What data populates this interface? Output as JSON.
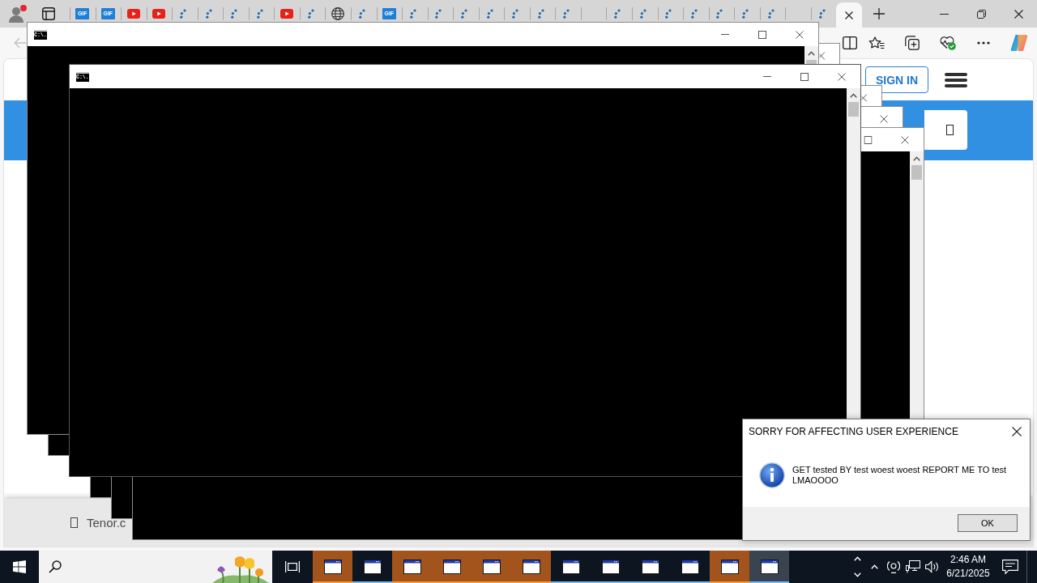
{
  "browser": {
    "back_button": {
      "disabled": true
    },
    "tabs": [
      {
        "kind": "gif",
        "icon_text": "GIF",
        "selected": false
      },
      {
        "kind": "gif",
        "icon_text": "GIF",
        "selected": false
      },
      {
        "kind": "youtube",
        "selected": false
      },
      {
        "kind": "youtube",
        "selected": false
      },
      {
        "kind": "loading",
        "selected": false
      },
      {
        "kind": "loading",
        "selected": false
      },
      {
        "kind": "loading",
        "selected": false
      },
      {
        "kind": "loading",
        "selected": false
      },
      {
        "kind": "youtube",
        "selected": false
      },
      {
        "kind": "loading",
        "selected": false
      },
      {
        "kind": "globe",
        "selected": false
      },
      {
        "kind": "loading",
        "selected": false
      },
      {
        "kind": "gif",
        "icon_text": "GIF",
        "selected": false
      },
      {
        "kind": "loading",
        "selected": false
      },
      {
        "kind": "loading",
        "selected": false
      },
      {
        "kind": "loading",
        "selected": false
      },
      {
        "kind": "loading",
        "selected": false
      },
      {
        "kind": "loading",
        "selected": false
      },
      {
        "kind": "loading",
        "selected": false
      },
      {
        "kind": "loading",
        "selected": false
      },
      {
        "kind": "blank",
        "selected": false
      },
      {
        "kind": "loading",
        "selected": false
      },
      {
        "kind": "loading",
        "selected": false
      },
      {
        "kind": "loading",
        "selected": false
      },
      {
        "kind": "loading",
        "selected": false
      },
      {
        "kind": "loading",
        "selected": false
      },
      {
        "kind": "loading",
        "selected": false
      },
      {
        "kind": "loading",
        "selected": false
      },
      {
        "kind": "blank",
        "selected": false
      },
      {
        "kind": "loading",
        "selected": false
      },
      {
        "kind": "blank",
        "selected": true
      }
    ]
  },
  "page": {
    "sign_in": "SIGN IN",
    "footer_text": "Tenor.c"
  },
  "console_windows": [
    {
      "icon_text": "C:\\.",
      "focused": false
    },
    {
      "focused": false
    },
    {
      "icon_text": "C:\\.",
      "focused": true
    },
    {
      "focused": false
    },
    {
      "focused": false
    },
    {
      "focused": false
    }
  ],
  "dialog": {
    "title": "SORRY FOR AFFECTING USER EXPERIENCE",
    "message": "GET tested BY test woest woest REPORT ME TO test LMAOOOO",
    "button": "OK"
  },
  "taskbar": {
    "items": [
      {
        "flashing": true,
        "selected": false
      },
      {
        "flashing": false,
        "selected": false
      },
      {
        "flashing": true,
        "selected": false
      },
      {
        "flashing": true,
        "selected": false
      },
      {
        "flashing": true,
        "selected": false
      },
      {
        "flashing": true,
        "selected": false
      },
      {
        "flashing": false,
        "selected": false
      },
      {
        "flashing": false,
        "selected": false
      },
      {
        "flashing": false,
        "selected": false
      },
      {
        "flashing": false,
        "selected": false
      },
      {
        "flashing": true,
        "selected": false
      },
      {
        "flashing": false,
        "selected": true
      }
    ],
    "time": "2:46 AM",
    "date": "6/21/2025"
  }
}
